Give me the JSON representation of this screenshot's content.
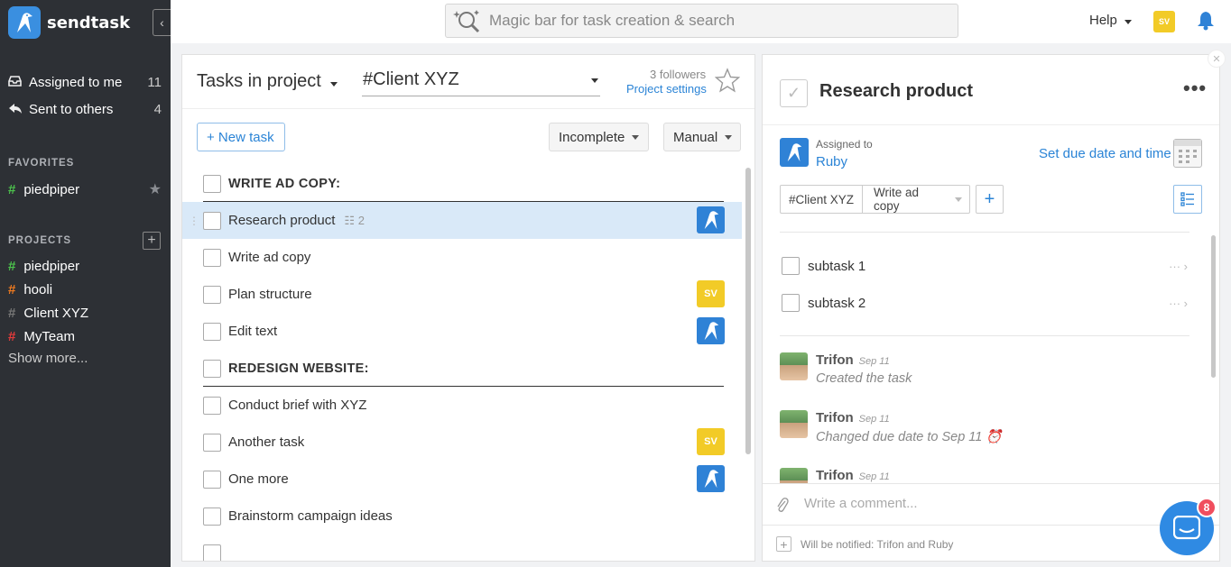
{
  "app": {
    "name": "sendtask"
  },
  "sidebar": {
    "assigned_to_me": {
      "label": "Assigned to me",
      "count": "11"
    },
    "sent_to_others": {
      "label": "Sent to others",
      "count": "4"
    },
    "favorites_heading": "FAVORITES",
    "favorites": [
      {
        "hash": "#",
        "label": "piedpiper",
        "color": "#4cc24c"
      }
    ],
    "projects_heading": "PROJECTS",
    "projects": [
      {
        "hash": "#",
        "label": "piedpiper",
        "color": "#4cc24c"
      },
      {
        "hash": "#",
        "label": "hooli",
        "color": "#f07a1f"
      },
      {
        "hash": "#",
        "label": "Client XYZ",
        "color": "#777777"
      },
      {
        "hash": "#",
        "label": "MyTeam",
        "color": "#e23b3b"
      }
    ],
    "show_more": "Show more..."
  },
  "topbar": {
    "search_placeholder": "Magic bar for task creation & search",
    "help_label": "Help",
    "user_initials": "SV"
  },
  "task_list": {
    "title": "Tasks in project",
    "project": "#Client XYZ",
    "followers": "3 followers",
    "project_settings": "Project settings",
    "new_task": "+ New task",
    "filter": "Incomplete",
    "sort": "Manual",
    "rows": [
      {
        "label": "WRITE AD COPY:",
        "section": true
      },
      {
        "label": "Research product",
        "subtasks": "2",
        "avatar": "blue",
        "selected": true
      },
      {
        "label": "Write ad copy"
      },
      {
        "label": "Plan structure",
        "avatar": "SV"
      },
      {
        "label": "Edit text",
        "avatar": "blue"
      },
      {
        "label": "REDESIGN WEBSITE:",
        "section": true
      },
      {
        "label": "Conduct brief with XYZ"
      },
      {
        "label": "Another task",
        "avatar": "SV"
      },
      {
        "label": "One more",
        "avatar": "blue"
      },
      {
        "label": "Brainstorm campaign ideas"
      }
    ]
  },
  "detail": {
    "title": "Research product",
    "assigned_label": "Assigned to",
    "assignee": "Ruby",
    "due_link": "Set due date and time",
    "tag_project": "#Client XYZ",
    "tag_section": "Write ad copy",
    "subtasks": [
      {
        "label": "subtask 1"
      },
      {
        "label": "subtask 2"
      }
    ],
    "activity": [
      {
        "name": "Trifon",
        "date": "Sep 11",
        "text": "Created the task"
      },
      {
        "name": "Trifon",
        "date": "Sep 11",
        "text": "Changed due date to Sep 11 ⏰"
      },
      {
        "name": "Trifon",
        "date": "Sep 11",
        "text": ""
      }
    ],
    "comment_placeholder": "Write a comment...",
    "notify_text": "Will be notified: Trifon and Ruby"
  },
  "chat": {
    "badge": "8"
  },
  "colors": {
    "accent": "#2b84d6",
    "sidebar_bg": "#2d3035",
    "sv_yellow": "#f2cb27",
    "selected_row": "#d9e9f8"
  }
}
